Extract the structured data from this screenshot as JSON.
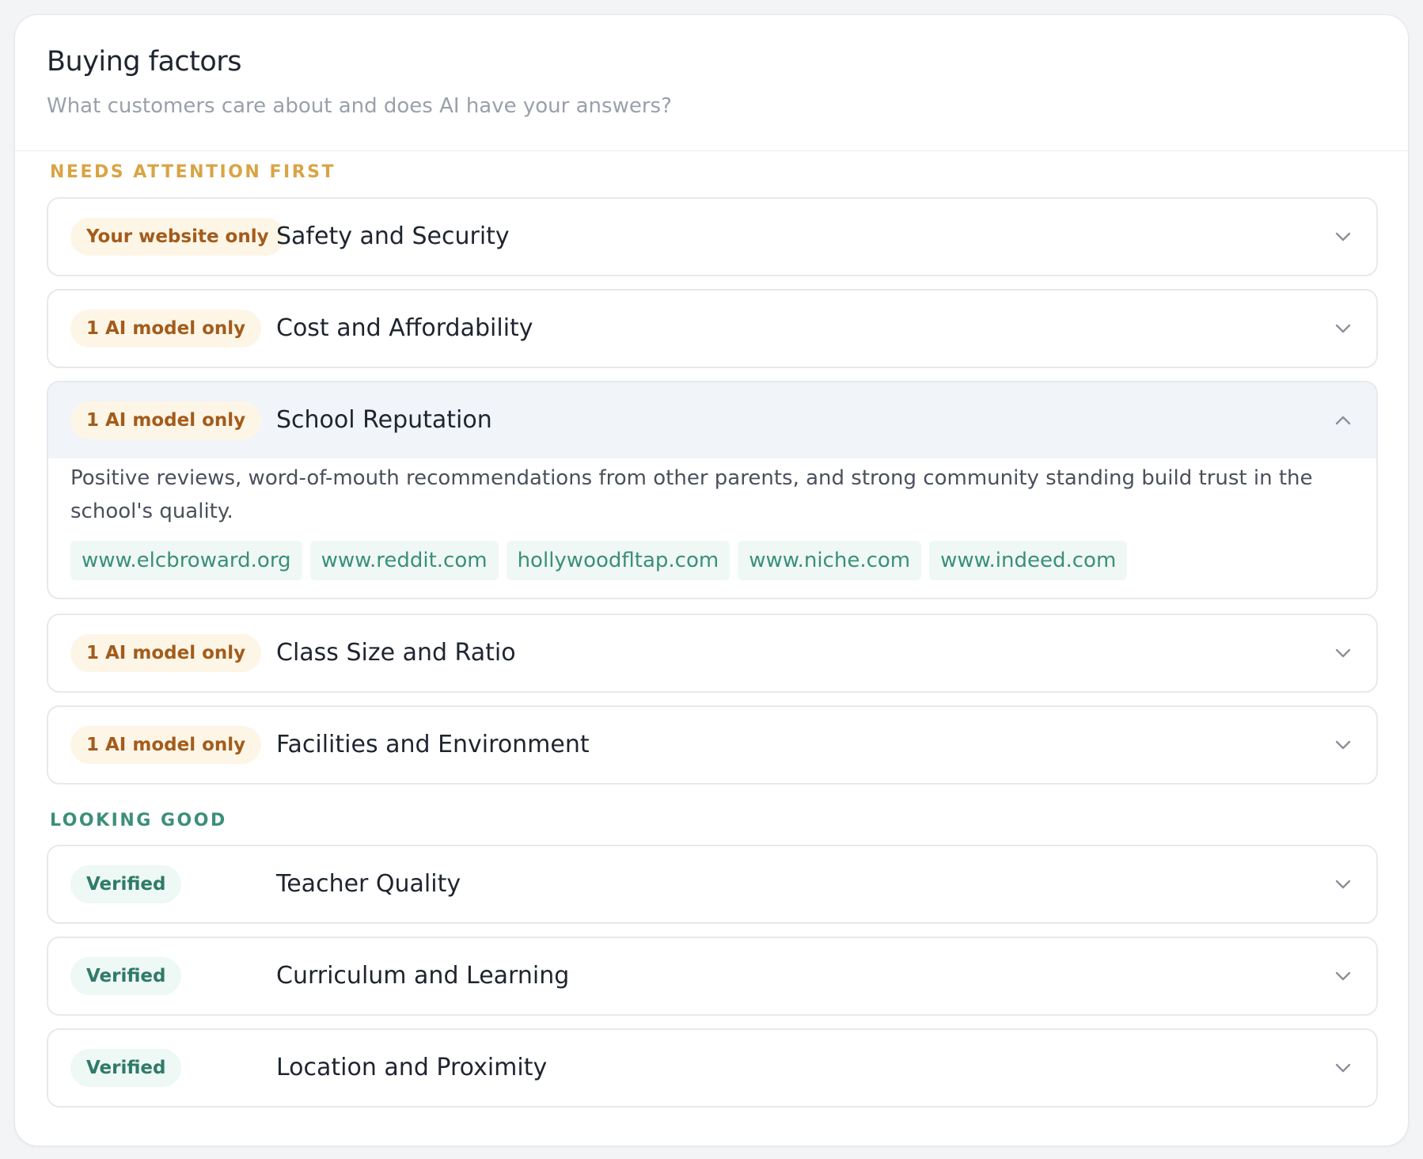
{
  "header": {
    "title": "Buying factors",
    "subtitle": "What customers care about and does AI have your answers?"
  },
  "sections": {
    "attention_label": "NEEDS ATTENTION FIRST",
    "good_label": "LOOKING GOOD"
  },
  "rows": [
    {
      "badge": "Your website only",
      "title": "Safety and Security",
      "status": "warning",
      "expanded": false
    },
    {
      "badge": "1 AI model only",
      "title": "Cost and Affordability",
      "status": "warning",
      "expanded": false
    },
    {
      "badge": "1 AI model only",
      "title": "School Reputation",
      "status": "warning",
      "expanded": true,
      "description": "Positive reviews, word-of-mouth recommendations from other parents, and strong community standing build trust in the school's quality.",
      "sources": [
        "www.elcbroward.org",
        "www.reddit.com",
        "hollywoodfltap.com",
        "www.niche.com",
        "www.indeed.com"
      ]
    },
    {
      "badge": "1 AI model only",
      "title": "Class Size and Ratio",
      "status": "warning",
      "expanded": false
    },
    {
      "badge": "1 AI model only",
      "title": "Facilities and Environment",
      "status": "warning",
      "expanded": false
    },
    {
      "badge": "Verified",
      "title": "Teacher Quality",
      "status": "verified",
      "expanded": false
    },
    {
      "badge": "Verified",
      "title": "Curriculum and Learning",
      "status": "verified",
      "expanded": false
    },
    {
      "badge": "Verified",
      "title": "Location and Proximity",
      "status": "verified",
      "expanded": false
    }
  ],
  "icons": {
    "collapsed": "chevron-down-icon",
    "expanded": "chevron-up-icon"
  },
  "colors": {
    "attention_label": "#d9a444",
    "good_label": "#3c8f7a",
    "warning_badge_bg": "#fdf6e7",
    "warning_badge_text": "#a35c1c",
    "verified_badge_bg": "#eef8f4",
    "verified_badge_text": "#2f7a68",
    "source_chip_text": "#3a8f79"
  }
}
